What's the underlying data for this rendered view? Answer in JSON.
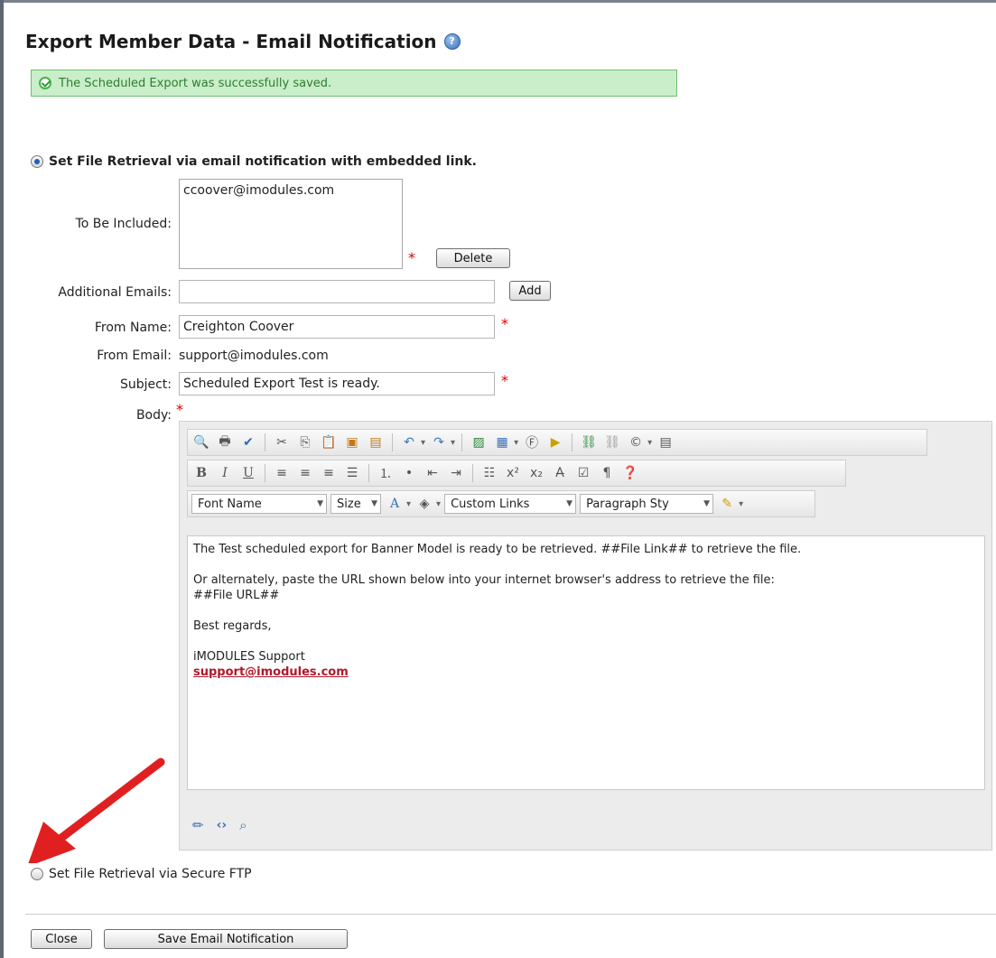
{
  "page": {
    "title": "Export Member Data - Email Notification",
    "success_message": "The Scheduled Export was successfully saved."
  },
  "email_option": {
    "label": "Set File Retrieval via email notification with embedded link.",
    "selected": true
  },
  "form": {
    "to_be_included_label": "To Be Included:",
    "to_be_included_items": [
      "ccoover@imodules.com"
    ],
    "delete_button": "Delete",
    "additional_emails_label": "Additional Emails:",
    "additional_emails_value": "",
    "add_button": "Add",
    "from_name_label": "From Name:",
    "from_name_value": "Creighton Coover",
    "from_email_label": "From Email:",
    "from_email_value": "support@imodules.com",
    "subject_label": "Subject:",
    "subject_value": "Scheduled Export Test is ready.",
    "body_label": "Body:",
    "required_marker": "*"
  },
  "editor": {
    "font_name": "Font Name",
    "size": "Size",
    "custom_links": "Custom Links",
    "paragraph_style": "Paragraph Sty",
    "body": {
      "line1": "The Test scheduled export for Banner Model is ready to be retrieved. ##File Link## to retrieve the file.",
      "line2": "Or alternately, paste the URL shown below into your internet browser's address to retrieve the file:",
      "line3": "##File URL##",
      "line4": "Best regards,",
      "line5": "iMODULES Support",
      "link": "support@imodules.com"
    }
  },
  "ftp_option": {
    "label": "Set File Retrieval via Secure FTP",
    "selected": false
  },
  "footer": {
    "close_button": "Close",
    "save_button": "Save Email Notification"
  },
  "colors": {
    "success_bg": "#c9eec9",
    "success_text": "#2e7d32",
    "required": "#dd0000",
    "link": "#b0182a",
    "arrow": "#e02020"
  }
}
